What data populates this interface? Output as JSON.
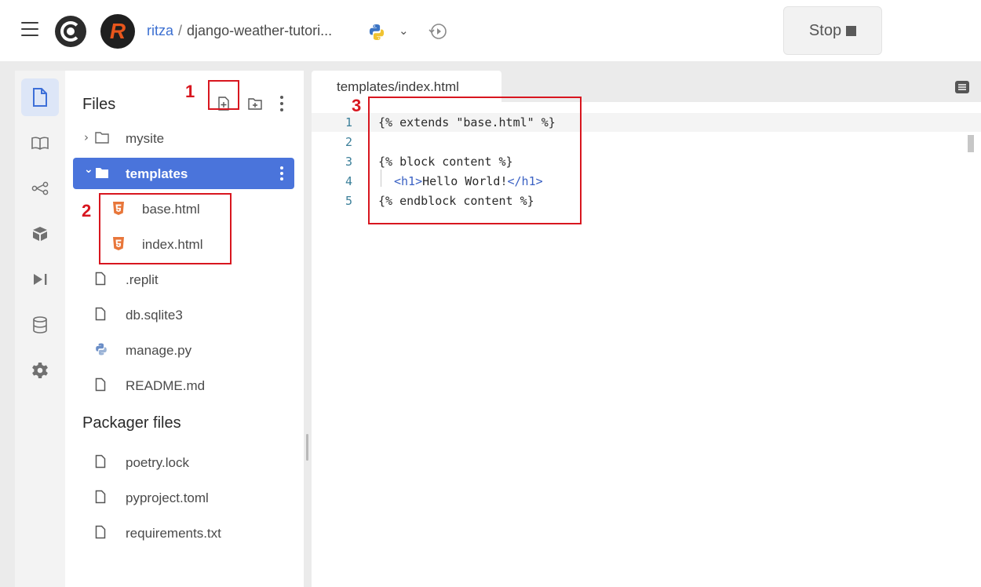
{
  "topbar": {
    "owner": "ritza",
    "separator": "/",
    "repl_name": "django-weather-tutori...",
    "avatar_letter": "R",
    "language_icon": "python-icon",
    "stop_label": "Stop"
  },
  "sidebar_rail": {
    "items": [
      "files-icon",
      "docs-book-icon",
      "version-control-icon",
      "packages-icon",
      "debugger-icon",
      "database-icon",
      "settings-icon"
    ],
    "active": "files-icon"
  },
  "files_panel": {
    "title": "Files",
    "tree": [
      {
        "label": "mysite",
        "type": "folder",
        "expanded": false
      },
      {
        "label": "templates",
        "type": "folder",
        "expanded": true,
        "selected": true
      },
      {
        "label": "base.html",
        "type": "html-file",
        "depth": 1
      },
      {
        "label": "index.html",
        "type": "html-file",
        "depth": 1
      },
      {
        "label": ".replit",
        "type": "file"
      },
      {
        "label": "db.sqlite3",
        "type": "file"
      },
      {
        "label": "manage.py",
        "type": "python-file"
      },
      {
        "label": "README.md",
        "type": "file"
      }
    ],
    "packager_title": "Packager files",
    "packager_files": [
      "poetry.lock",
      "pyproject.toml",
      "requirements.txt"
    ]
  },
  "editor": {
    "tab_label": "templates/index.html",
    "lines": [
      {
        "n": "1",
        "text": "{% extends \"base.html\" %}"
      },
      {
        "n": "2",
        "text": ""
      },
      {
        "n": "3",
        "text": "{% block content %}"
      },
      {
        "n": "4",
        "open": "<h1>",
        "inner": "Hello World!",
        "close": "</h1>"
      },
      {
        "n": "5",
        "text": "{% endblock content %}"
      }
    ]
  },
  "annotations": [
    {
      "label": "1",
      "target": "new-file-button"
    },
    {
      "label": "2",
      "target": "template-files"
    },
    {
      "label": "3",
      "target": "code-block"
    }
  ],
  "colors": {
    "accent": "#4a74db",
    "annotation_red": "#d8161f",
    "html_icon": "#e8763a",
    "line_number": "#3b7f99"
  }
}
